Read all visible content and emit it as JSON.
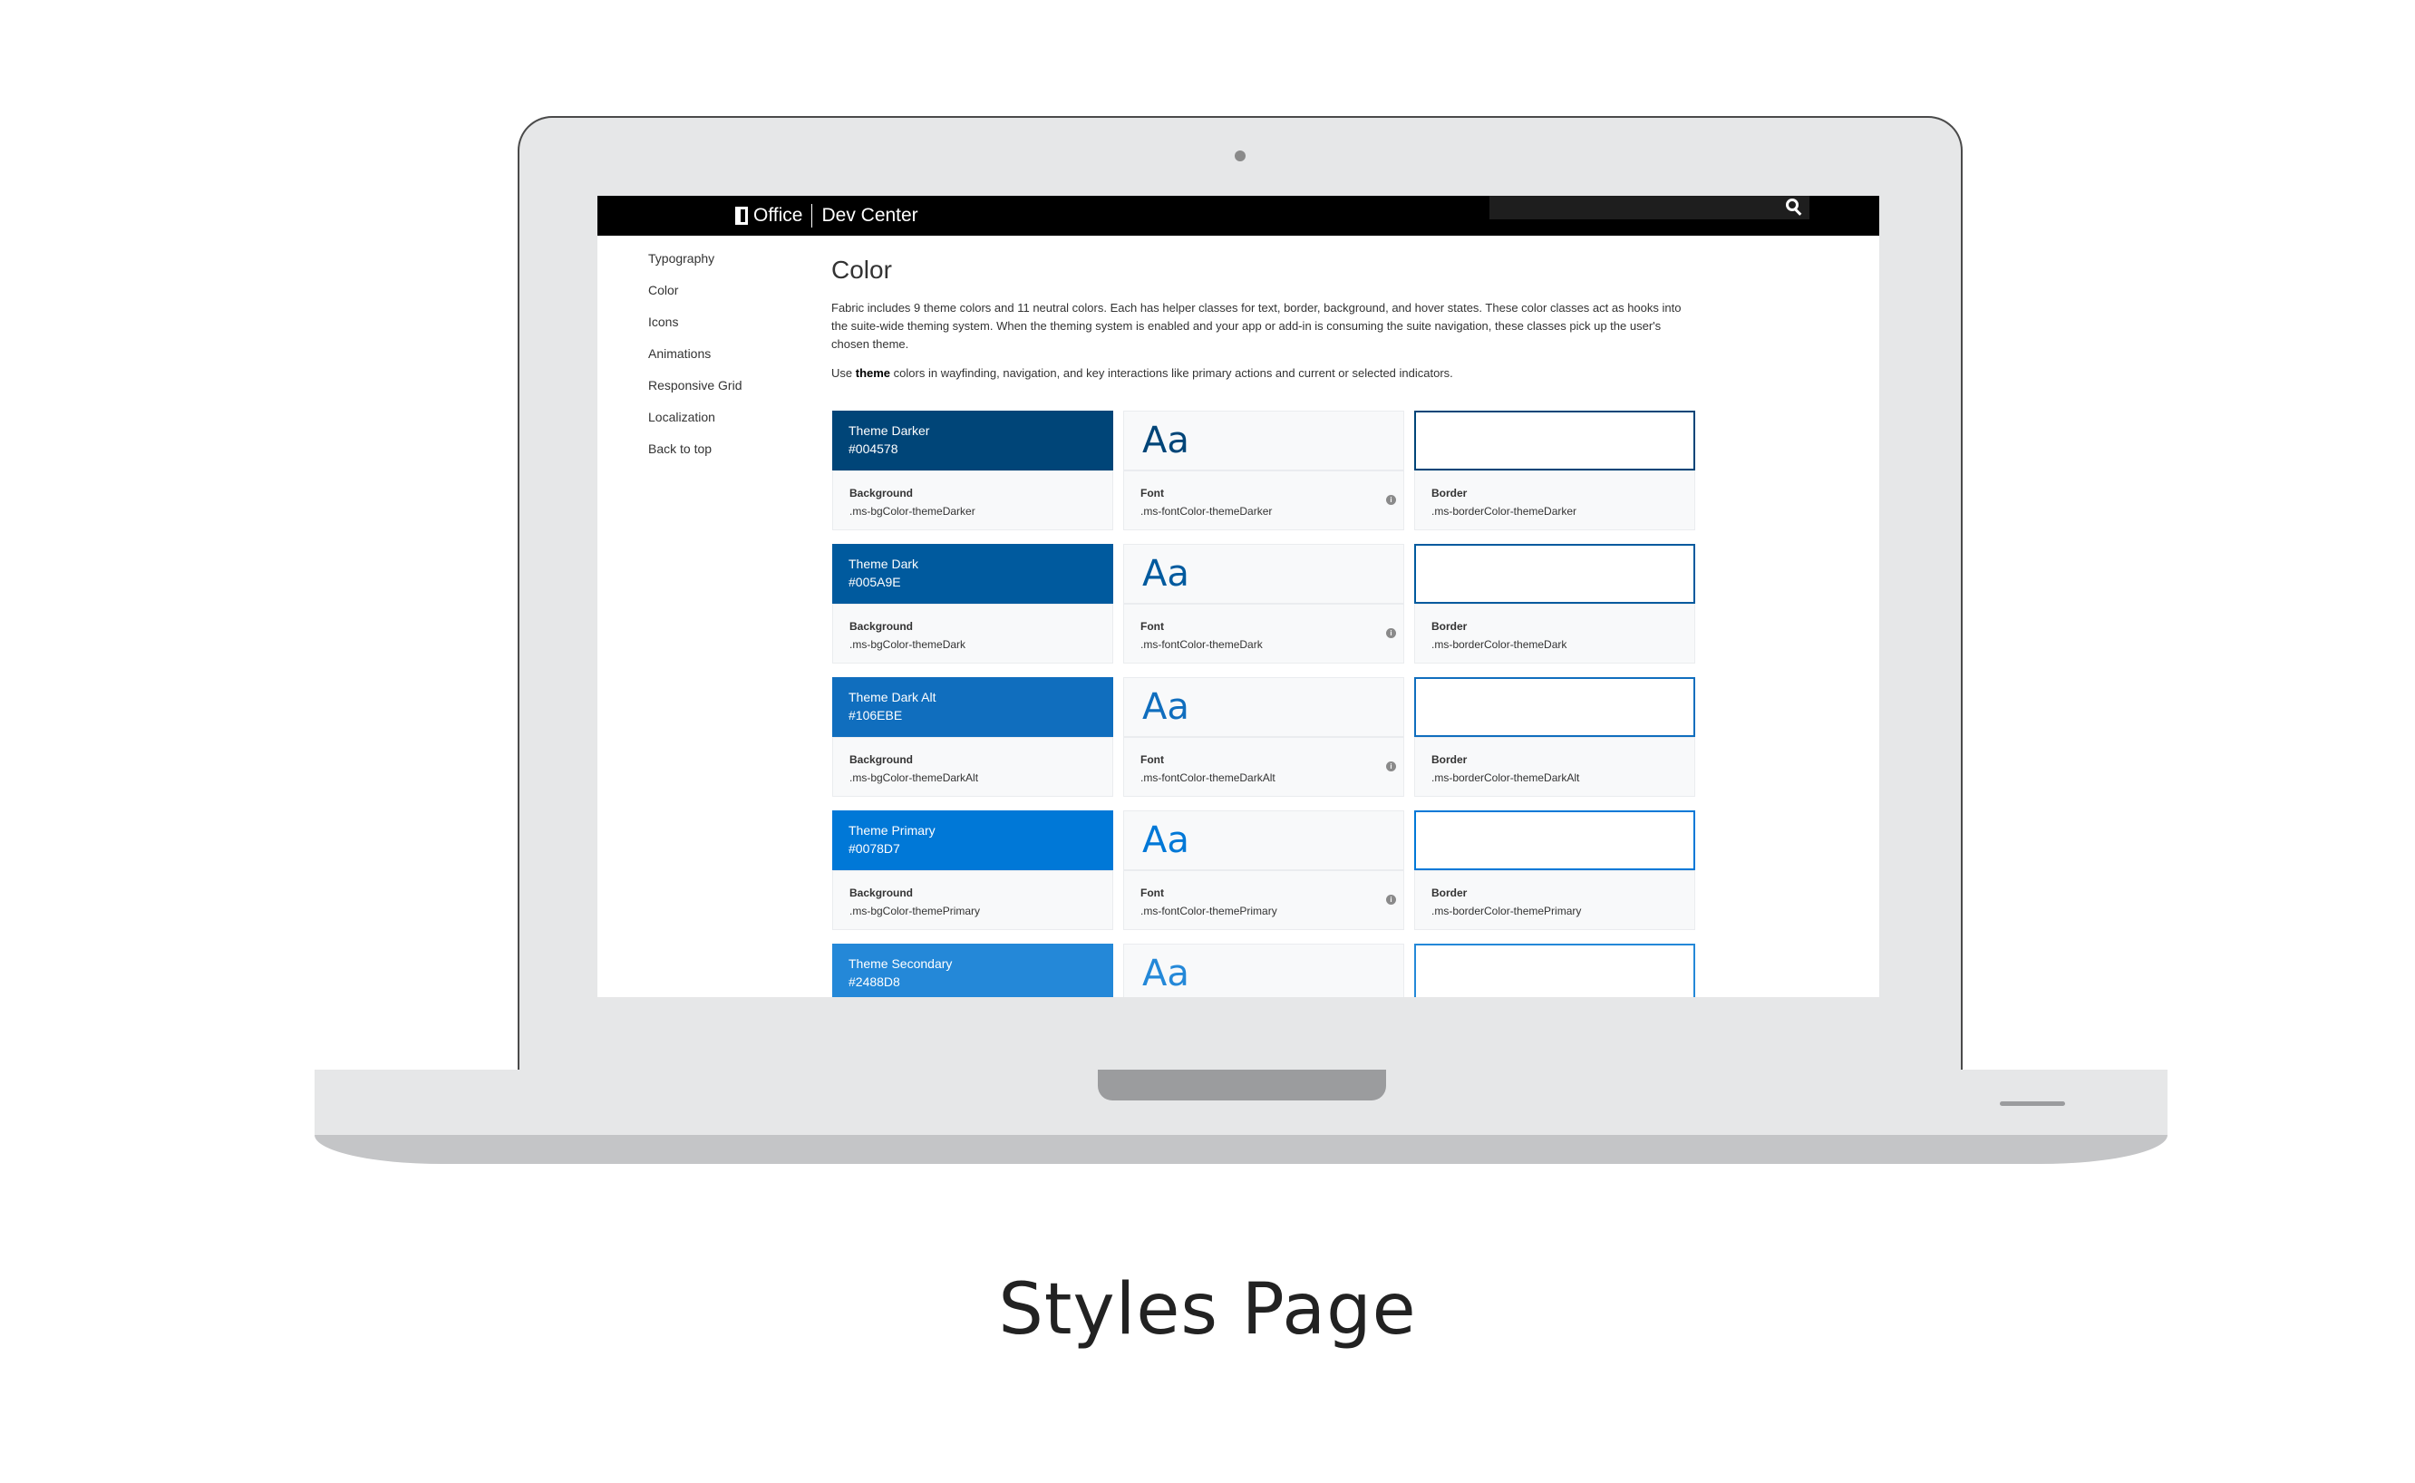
{
  "app": {
    "brand": "Office",
    "product": "Dev Center"
  },
  "nav": {
    "items": [
      "Typography",
      "Color",
      "Icons",
      "Animations",
      "Responsive Grid",
      "Localization",
      "Back to top"
    ]
  },
  "content": {
    "title": "Color",
    "intro": "Fabric includes 9 theme colors and 11 neutral colors. Each has helper classes for text, border, background, and hover states. These color classes act as hooks into the suite-wide theming system. When the theming system is enabled and your app or add-in is consuming the suite navigation, these classes pick up the user's chosen theme.",
    "theme_prefix": "Use",
    "theme_word": "theme",
    "theme_suffix": "colors in wayfinding, navigation, and key interactions like primary actions and current or selected indicators."
  },
  "labels": {
    "background": "Background",
    "font": "Font",
    "border": "Border",
    "sample": "Aa"
  },
  "colors": [
    {
      "name": "Theme Darker",
      "hex": "#004578",
      "bg_class": ".ms-bgColor-themeDarker",
      "font_class": ".ms-fontColor-themeDarker",
      "border_class": ".ms-borderColor-themeDarker"
    },
    {
      "name": "Theme Dark",
      "hex": "#005A9E",
      "bg_class": ".ms-bgColor-themeDark",
      "font_class": ".ms-fontColor-themeDark",
      "border_class": ".ms-borderColor-themeDark"
    },
    {
      "name": "Theme Dark Alt",
      "hex": "#106EBE",
      "bg_class": ".ms-bgColor-themeDarkAlt",
      "font_class": ".ms-fontColor-themeDarkAlt",
      "border_class": ".ms-borderColor-themeDarkAlt"
    },
    {
      "name": "Theme Primary",
      "hex": "#0078D7",
      "bg_class": ".ms-bgColor-themePrimary",
      "font_class": ".ms-fontColor-themePrimary",
      "border_class": ".ms-borderColor-themePrimary"
    },
    {
      "name": "Theme Secondary",
      "hex": "#2488D8",
      "bg_class": "",
      "font_class": "",
      "border_class": ""
    }
  ],
  "caption": "Styles Page"
}
